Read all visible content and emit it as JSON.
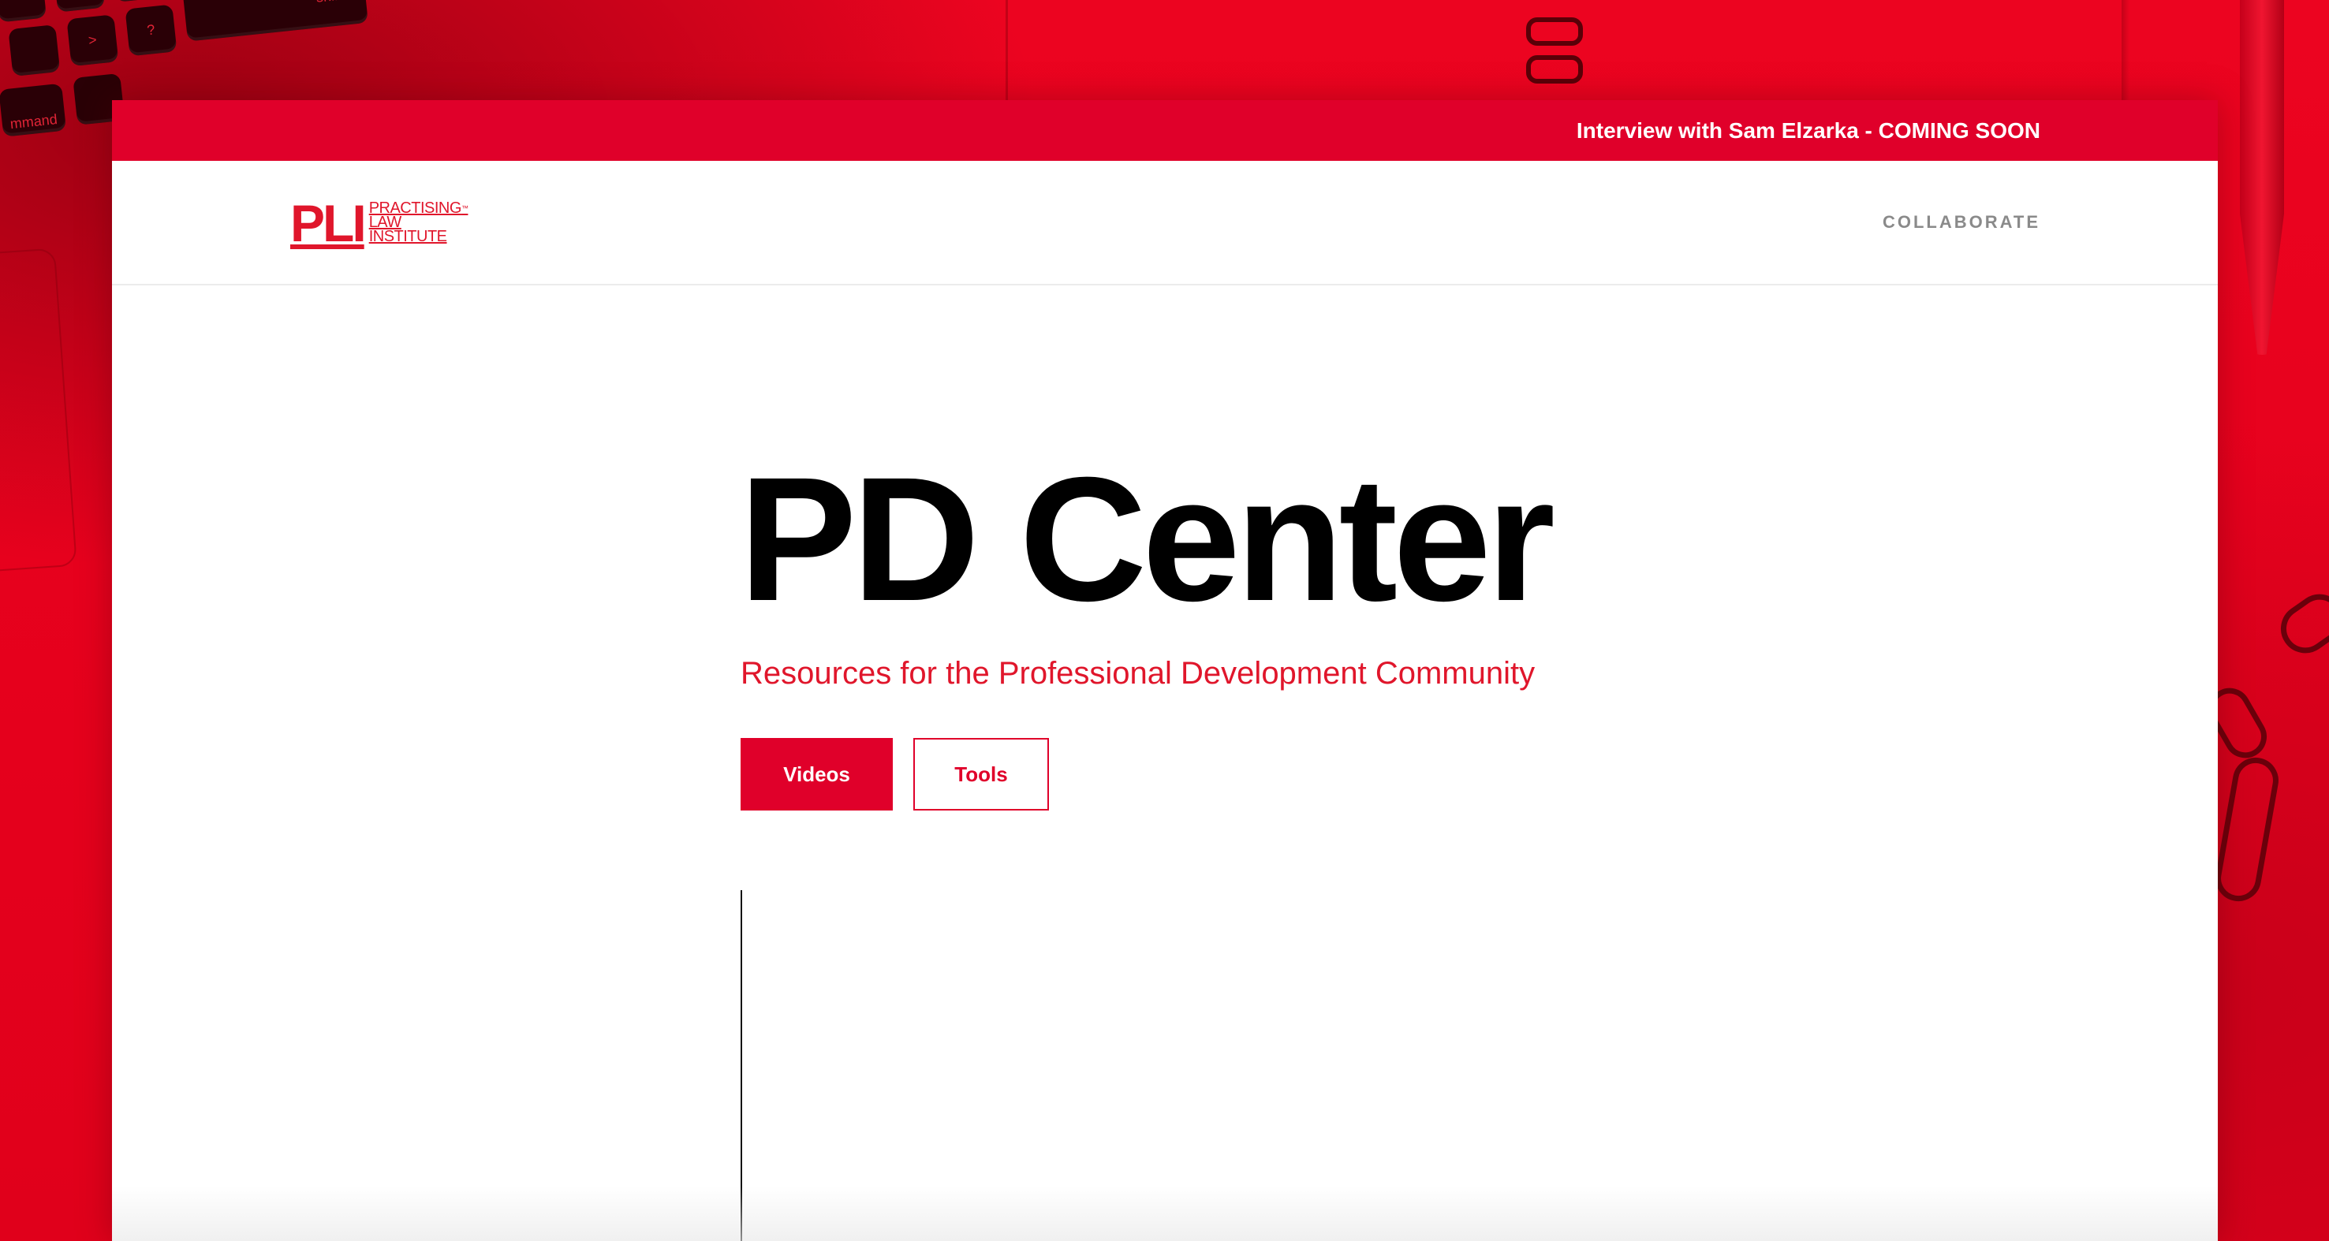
{
  "announcement": {
    "text": "Interview with Sam Elzarka - COMING SOON"
  },
  "header": {
    "logo": {
      "mark": "PLI",
      "line1": "PRACTISING",
      "line2": "LAW",
      "line3": "INSTITUTE"
    },
    "nav": {
      "collaborate": "COLLABORATE"
    }
  },
  "hero": {
    "title": "PD Center",
    "subtitle": "Resources for the Professional Development Community",
    "buttons": {
      "videos": "Videos",
      "tools": "Tools"
    }
  },
  "background_keys": {
    "k1": ">",
    "k2": "?",
    "k3": "shift",
    "k4": "mmand"
  },
  "colors": {
    "brand_red": "#e0002a",
    "logo_red": "#e0162b",
    "background_red": "#e8001f",
    "nav_gray": "#8a8a8a"
  }
}
